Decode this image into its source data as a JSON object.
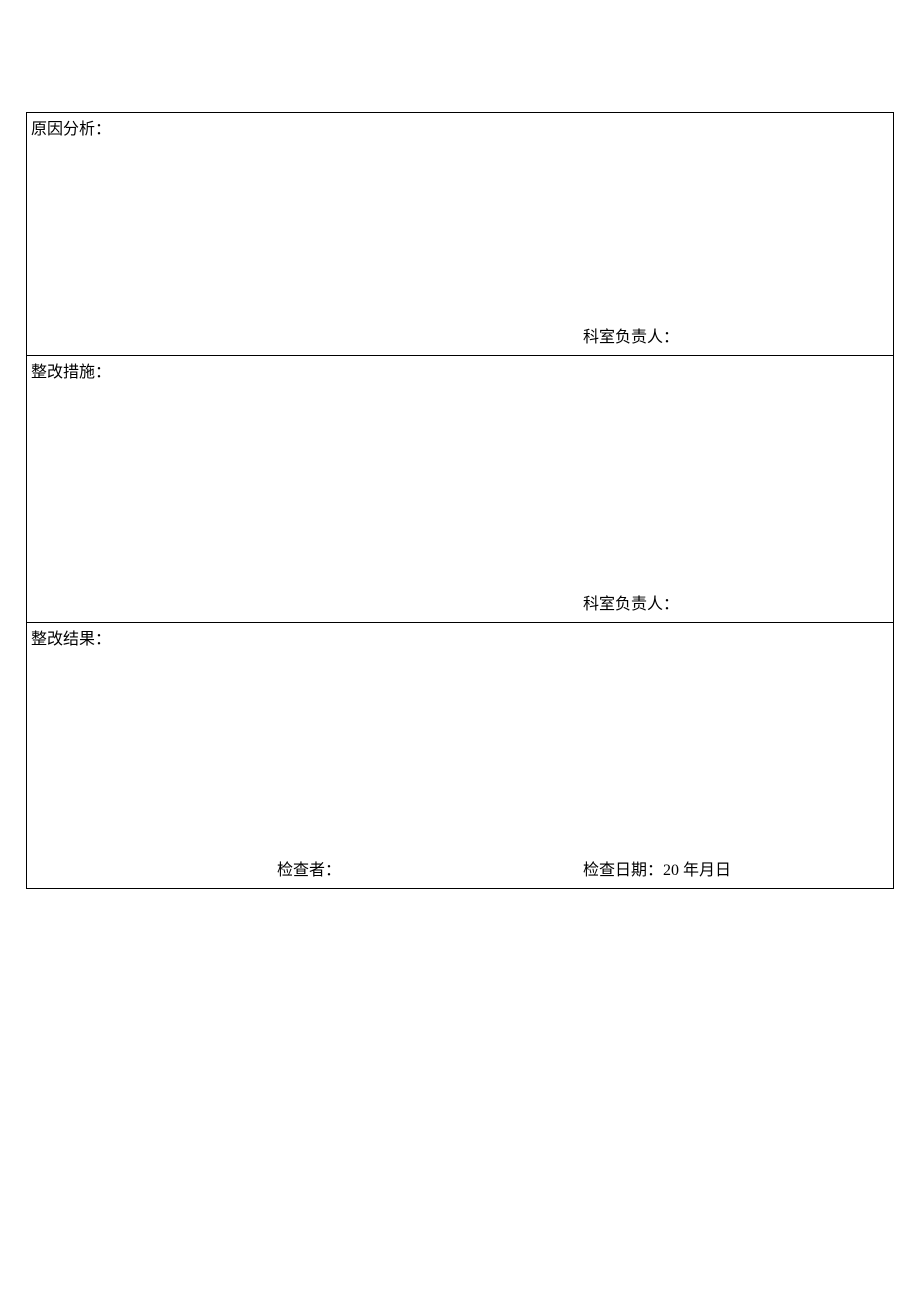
{
  "sections": {
    "cause_analysis": {
      "label": "原因分析：",
      "signature_label": "科室负责人："
    },
    "corrective_measures": {
      "label": "整改措施：",
      "signature_label": "科室负责人："
    },
    "corrective_results": {
      "label": "整改结果：",
      "inspector_label": "检查者：",
      "date_label": "检查日期：20 年月日"
    }
  }
}
